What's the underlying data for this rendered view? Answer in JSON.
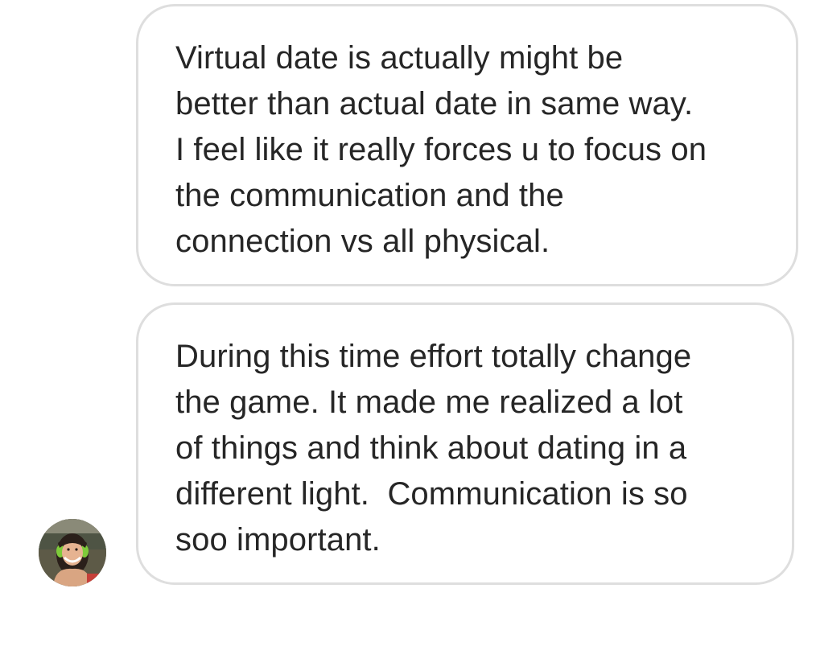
{
  "thread": {
    "messages": [
      {
        "lines": [
          "Virtual date is actually might be",
          "better than actual date in same way.",
          "I feel like it really forces u to focus on",
          "the communication and the",
          "connection vs all physical."
        ]
      },
      {
        "lines": [
          "During this time effort totally change",
          "the game. It made me realized a lot",
          "of things and think about dating in a",
          "different light.  Communication is so",
          "soo important."
        ]
      }
    ]
  },
  "avatar": {
    "icon": "user-avatar-photo"
  },
  "colors": {
    "background": "#ffffff",
    "bubble_border": "#dedede",
    "text": "#262626"
  }
}
